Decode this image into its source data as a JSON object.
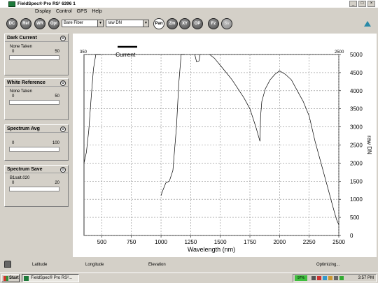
{
  "window": {
    "title": "FieldSpec® Pro RS²  6396 1"
  },
  "menu": [
    "Display",
    "Control",
    "GPS",
    "Help"
  ],
  "toolbar": {
    "buttons": [
      "DC",
      "Ref",
      "WR",
      "Opt"
    ],
    "selects": [
      {
        "value": "Bare Fiber"
      },
      {
        "value": "raw DN"
      }
    ],
    "view_buttons": [
      "Pan",
      "Zm",
      "XY",
      "OP",
      "Fz",
      "Sv"
    ]
  },
  "panels": {
    "dark_current": {
      "title": "Dark Current",
      "status": "None Taken",
      "min": "0",
      "max": "50",
      "level": 0
    },
    "white_reference": {
      "title": "White Reference",
      "status": "None Taken",
      "min": "0",
      "max": "50",
      "level": 0
    },
    "spectrum_avg": {
      "title": "Spectrum Avg",
      "min": "0",
      "max": "100",
      "level": 0
    },
    "spectrum_save": {
      "title": "Spectrum Save",
      "status": "B1salt.020",
      "min": "0",
      "max": "20",
      "level": 0
    }
  },
  "chart_data": {
    "type": "line",
    "title": "",
    "xlabel": "Wavelength (nm)",
    "ylabel": "raw DN",
    "legend": "Current",
    "xrange_labels": {
      "left": "350",
      "right": "2500"
    },
    "xlim": [
      350,
      2500
    ],
    "ylim": [
      0,
      5000
    ],
    "x_ticks": [
      500,
      750,
      1000,
      1250,
      1500,
      1750,
      2000,
      2250,
      2500
    ],
    "y_ticks": [
      0,
      500,
      1000,
      1500,
      2000,
      2500,
      3000,
      3500,
      4000,
      4500,
      5000
    ],
    "grid": true,
    "series": [
      {
        "name": "Current",
        "segments": [
          {
            "x": [
              350,
              370,
              390,
              410,
              430,
              450,
              470,
              490
            ],
            "y": [
              2000,
              2300,
              2900,
              3800,
              4600,
              5000,
              5000,
              5000
            ]
          },
          {
            "x": [
              1000,
              1010,
              1040,
              1070,
              1100,
              1130,
              1150,
              1170,
              1190,
              1200
            ],
            "y": [
              1100,
              1200,
              1450,
              1500,
              1800,
              3000,
              4200,
              5000,
              5000,
              5000
            ]
          },
          {
            "x": [
              1285,
              1300,
              1320,
              1330
            ],
            "y": [
              5000,
              4800,
              4820,
              5000
            ]
          },
          {
            "x": [
              1410,
              1450,
              1500,
              1550,
              1600,
              1650,
              1700,
              1750,
              1800,
              1835,
              1840,
              1850,
              1880,
              1920,
              1960,
              2000,
              2050,
              2100,
              2150,
              2200,
              2250,
              2300,
              2350,
              2400,
              2450,
              2480,
              2500
            ],
            "y": [
              5000,
              4900,
              4700,
              4500,
              4300,
              4050,
              3800,
              3500,
              3000,
              2600,
              3300,
              3700,
              4050,
              4300,
              4450,
              4550,
              4450,
              4300,
              4000,
              3700,
              3300,
              2600,
              2000,
              1400,
              800,
              450,
              300
            ]
          }
        ]
      }
    ]
  },
  "status_bar": {
    "latitude": "Latitude",
    "longitude": "Longitude",
    "elevation": "Elevation",
    "state": "Optimizing..."
  },
  "taskbar": {
    "start": "Start",
    "task": "FieldSpec® Pro RS²...",
    "battery": "97%",
    "clock": "3:57 PM"
  },
  "colors": {
    "panel_bg": "#d4d0c8",
    "plot_bg": "#ffffff",
    "grid": "#9a9a9a",
    "line": "#000000",
    "accent": "#2a8aa8"
  }
}
